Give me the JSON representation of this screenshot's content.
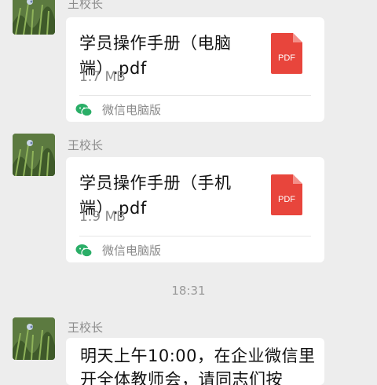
{
  "messages": [
    {
      "sender": "王校长",
      "file_name": "学员操作手册（电脑端）.pdf",
      "file_size": "1.7 MB",
      "file_icon_label": "PDF",
      "source": "微信电脑版"
    },
    {
      "sender": "王校长",
      "file_name": "学员操作手册（手机端）.pdf",
      "file_size": "1.9 MB",
      "file_icon_label": "PDF",
      "source": "微信电脑版"
    }
  ],
  "timestamp": "18:31",
  "text_message": {
    "sender": "王校长",
    "text": "明天上午10:00，在企业微信里开全体教师会，请同志们按"
  },
  "colors": {
    "background": "#ededed",
    "bubble": "#ffffff",
    "pdf_red": "#e8453c",
    "wechat_green": "#2aae67"
  }
}
